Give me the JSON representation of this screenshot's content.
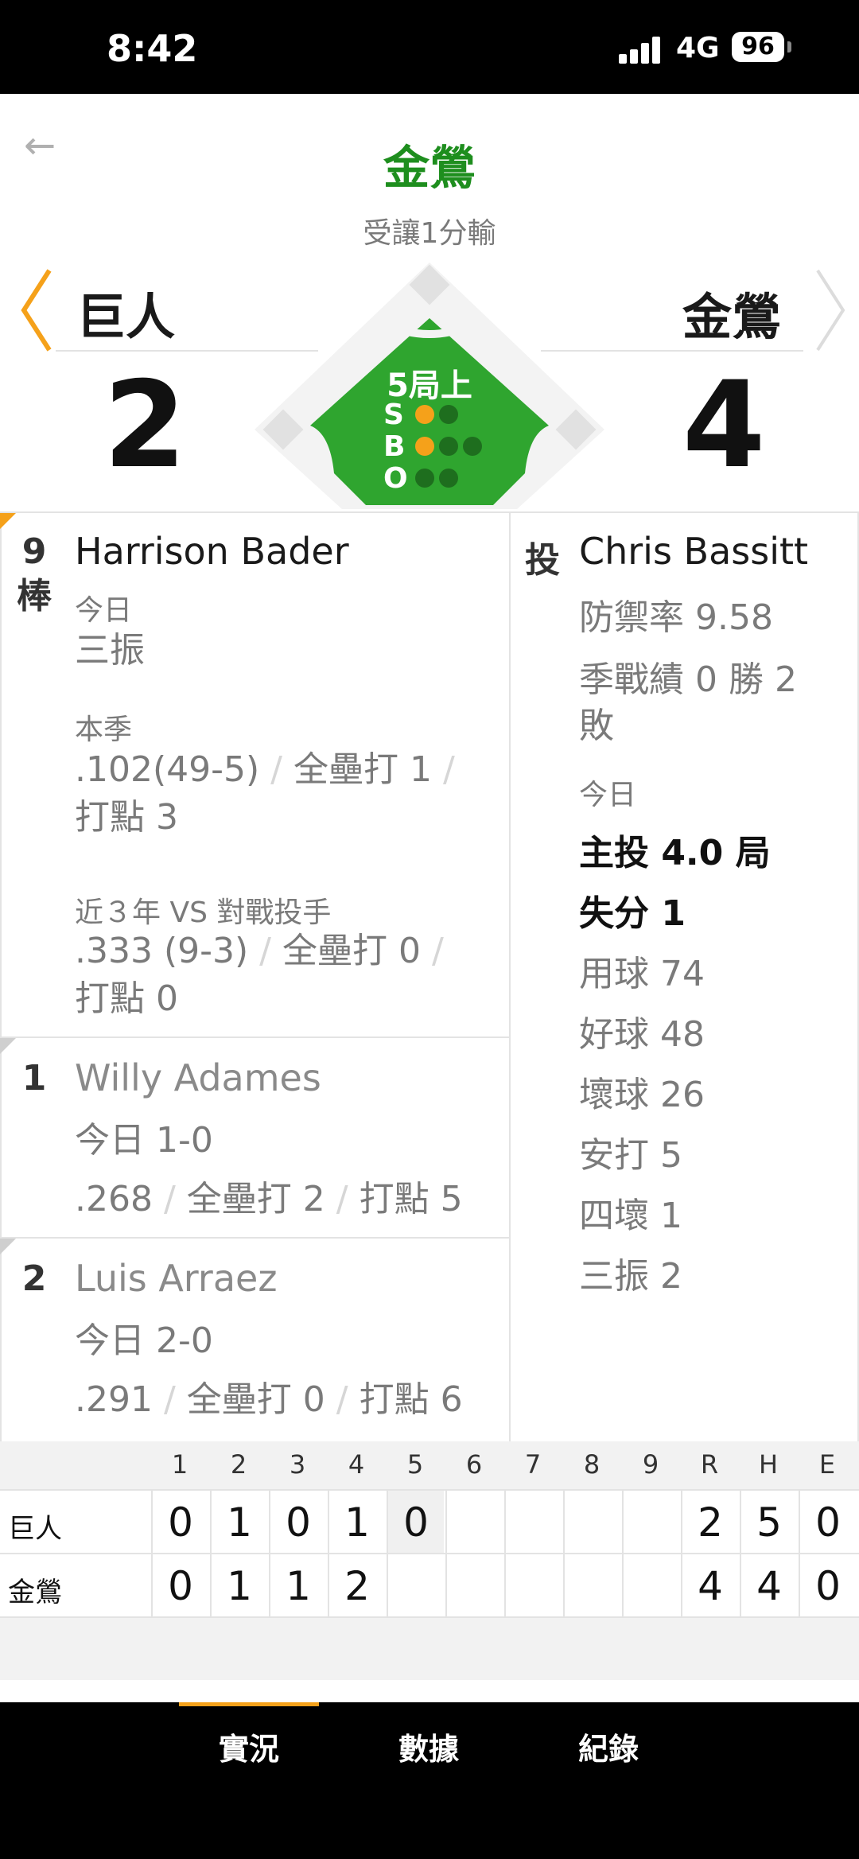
{
  "status_bar": {
    "time": "8:42",
    "network": "4G",
    "battery": "96"
  },
  "header": {
    "title": "金鶯",
    "subtitle": "受讓1分輸"
  },
  "teams": {
    "away": {
      "name": "巨人",
      "score": "2"
    },
    "home": {
      "name": "金鶯",
      "score": "4"
    }
  },
  "count": {
    "inning": "5局上",
    "labels": {
      "s": "S",
      "b": "B",
      "o": "O"
    },
    "strikes": 1,
    "balls": 1,
    "outs": 0
  },
  "current_batter": {
    "order": [
      "9",
      "棒"
    ],
    "name": "Harrison Bader",
    "today_label": "今日",
    "today_result": "三振",
    "season_label": "本季",
    "season_avg": ".102(49-5)",
    "season_hr": "全壘打 1",
    "season_rbi": "打點 3",
    "vs_label": "近３年 VS 對戰投手",
    "vs_avg": ".333 (9-3)",
    "vs_hr": "全壘打 0",
    "vs_rbi": "打點 0"
  },
  "on_deck": [
    {
      "order": "1",
      "name": "Willy Adames",
      "today": "今日 1-0",
      "avg": ".268",
      "hr": "全壘打 2",
      "rbi": "打點 5"
    },
    {
      "order": "2",
      "name": "Luis Arraez",
      "today": "今日 2-0",
      "avg": ".291",
      "hr": "全壘打 0",
      "rbi": "打點 6"
    }
  ],
  "pitcher": {
    "label": "投",
    "name": "Chris Bassitt",
    "era": "防禦率 9.58",
    "record_line1": "季戰績 0 勝 2",
    "record_line2": "敗",
    "today_label": "今日",
    "today_stats": [
      {
        "text": "主投 4.0 局",
        "bold": true
      },
      {
        "text": "失分 1",
        "bold": true
      },
      {
        "text": "用球 74",
        "bold": false
      },
      {
        "text": "好球 48",
        "bold": false
      },
      {
        "text": "壞球 26",
        "bold": false
      },
      {
        "text": "安打 5",
        "bold": false
      },
      {
        "text": "四壞 1",
        "bold": false
      },
      {
        "text": "三振 2",
        "bold": false
      }
    ]
  },
  "line_score": {
    "headers": [
      "1",
      "2",
      "3",
      "4",
      "5",
      "6",
      "7",
      "8",
      "9",
      "R",
      "H",
      "E"
    ],
    "rows": [
      {
        "team": "巨人",
        "cells": [
          "0",
          "1",
          "0",
          "1",
          "0",
          "",
          "",
          "",
          "",
          "2",
          "5",
          "0"
        ]
      },
      {
        "team": "金鶯",
        "cells": [
          "0",
          "1",
          "1",
          "2",
          "",
          "",
          "",
          "",
          "",
          "4",
          "4",
          "0"
        ]
      }
    ]
  },
  "tabs": [
    {
      "label": "實況",
      "active": true
    },
    {
      "label": "數據",
      "active": false
    },
    {
      "label": "紀錄",
      "active": false
    }
  ],
  "colors": {
    "accent": "#f5a11a",
    "field_green": "#2fa52f",
    "title_green": "#1e8e1e"
  }
}
